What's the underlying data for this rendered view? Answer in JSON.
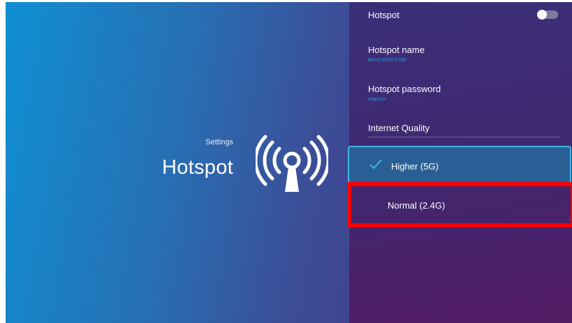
{
  "page": {
    "breadcrumb": "Settings",
    "title": "Hotspot",
    "icon": "wifi-hotspot-icon"
  },
  "panel": {
    "hotspot": {
      "label": "Hotspot",
      "toggle_on": false
    },
    "hotspot_name": {
      "label": "Hotspot name",
      "value": "BenQ E600-07db"
    },
    "hotspot_password": {
      "label": "Hotspot password",
      "value": "mlglycst"
    },
    "internet_quality": {
      "label": "Internet Quality",
      "options": [
        {
          "label": "Higher (5G)",
          "selected": true,
          "icon": "checkmark-icon"
        },
        {
          "label": "Normal (2.4G)",
          "selected": false
        }
      ]
    }
  },
  "colors": {
    "accent": "#3fb6e6",
    "highlight": "#ff0000",
    "subtext": "#2a98d8"
  }
}
